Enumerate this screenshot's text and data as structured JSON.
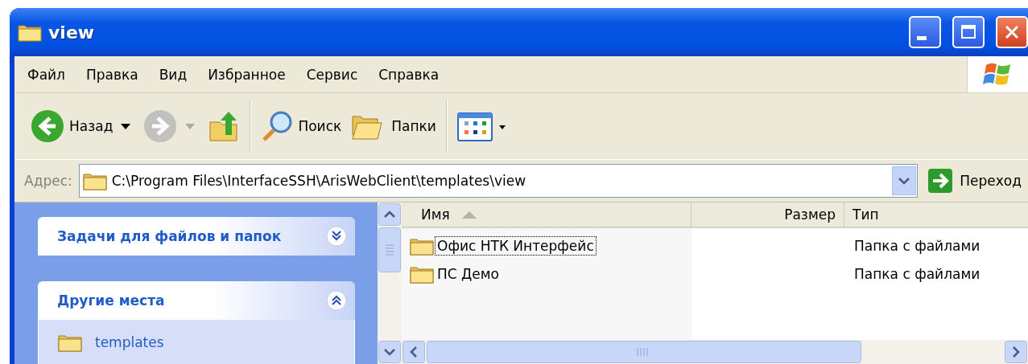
{
  "window": {
    "title": "view"
  },
  "menu": [
    "Файл",
    "Правка",
    "Вид",
    "Избранное",
    "Сервис",
    "Справка"
  ],
  "toolbar": [
    {
      "kind": "back",
      "label": "Назад"
    },
    {
      "kind": "forward",
      "disabled": true
    },
    {
      "kind": "up"
    },
    {
      "kind": "search",
      "label": "Поиск"
    },
    {
      "kind": "folders",
      "label": "Папки"
    },
    {
      "kind": "views"
    }
  ],
  "address": {
    "label": "Адрес:",
    "value": "C:\\Program Files\\InterfaceSSH\\ArisWebClient\\templates\\view",
    "go": "Переход"
  },
  "sidebar": [
    {
      "title": "Задачи для файлов и папок",
      "expanded": false
    },
    {
      "title": "Другие места",
      "expanded": true,
      "items": [
        "templates"
      ]
    }
  ],
  "columns": [
    {
      "label": "Имя",
      "sorted": true
    },
    {
      "label": "Размер",
      "sorted": false
    },
    {
      "label": "Тип",
      "sorted": false
    }
  ],
  "rows": [
    {
      "name": "Офис НТК Интерфейс",
      "type": "Папка с файлами",
      "focused": true
    },
    {
      "name": "ПС Демо",
      "type": "Папка с файлами",
      "focused": false
    }
  ]
}
